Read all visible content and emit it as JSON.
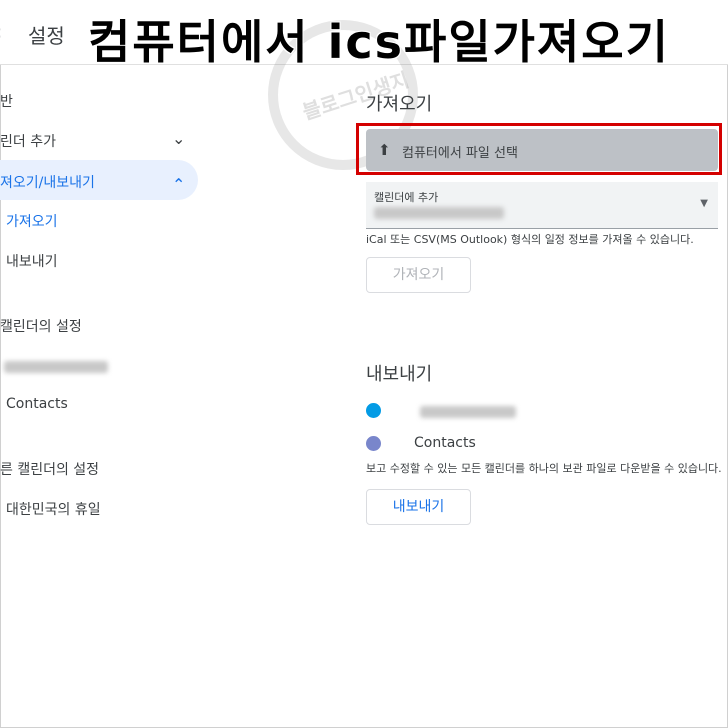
{
  "header": {
    "back_icon": "‹",
    "title": "설정",
    "overlay_title": "컴퓨터에서 ics파일가져오기",
    "watermark_text": "블로그인생지"
  },
  "sidebar": {
    "items": [
      {
        "label": "반"
      },
      {
        "label": "린더 추가"
      },
      {
        "label": "져오기/내보내기"
      },
      {
        "label": "가져오기"
      },
      {
        "label": "내보내기"
      },
      {
        "label": "캘린더의 설정"
      },
      {
        "label": "Contacts"
      },
      {
        "label": "른 캘린더의 설정"
      },
      {
        "label": "대한민국의 휴일"
      }
    ]
  },
  "import": {
    "heading": "가져오기",
    "file_button_label": "컴퓨터에서 파일 선택",
    "select_label": "캘린더에 추가",
    "hint": "iCal 또는 CSV(MS Outlook) 형식의 일정 정보를 가져올 수 있습니다.",
    "import_button_label": "가져오기"
  },
  "export": {
    "heading": "내보내기",
    "calendars": [
      {
        "name": "",
        "color": "#039be5"
      },
      {
        "name": "Contacts",
        "color": "#7986cb"
      }
    ],
    "hint": "보고 수정할 수 있는 모든 캘린더를 하나의 보관 파일로 다운받을 수 있습니다.",
    "export_button_label": "내보내기"
  },
  "colors": {
    "accent": "#1a73e8",
    "highlight_border": "#d40000",
    "active_bg": "#e8f0fe"
  }
}
